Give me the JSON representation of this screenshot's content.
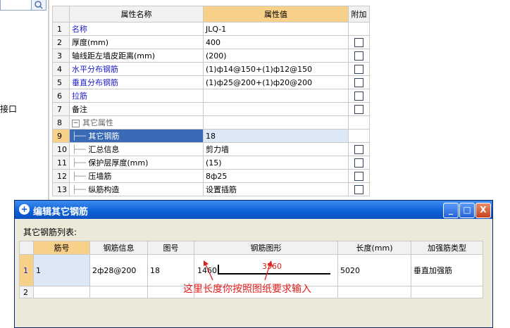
{
  "left_panel": {
    "label": "接口"
  },
  "prop_grid": {
    "headers": {
      "num": "",
      "name": "属性名称",
      "value": "属性值",
      "extra": "附加"
    },
    "rows": [
      {
        "n": "1",
        "name": "名称",
        "value": "JLQ-1",
        "checkbox": false
      },
      {
        "n": "2",
        "name": "厚度(mm)",
        "value": "400",
        "checkbox": true
      },
      {
        "n": "3",
        "name": "轴线距左墙皮距离(mm)",
        "value": "(200)",
        "checkbox": true
      },
      {
        "n": "4",
        "name": "水平分布钢筋",
        "value": "(1)ф14@150+(1)ф12@150",
        "checkbox": true
      },
      {
        "n": "5",
        "name": "垂直分布钢筋",
        "value": "(1)ф25@200+(1)ф20@200",
        "checkbox": true
      },
      {
        "n": "6",
        "name": "拉筋",
        "value": "",
        "checkbox": true
      },
      {
        "n": "7",
        "name": "备注",
        "value": "",
        "checkbox": true
      },
      {
        "n": "8",
        "name": "其它属性",
        "value": "",
        "checkbox": false
      },
      {
        "n": "9",
        "name": "其它钢筋",
        "value": "18",
        "checkbox": false
      },
      {
        "n": "10",
        "name": "汇总信息",
        "value": "剪力墙",
        "checkbox": true
      },
      {
        "n": "11",
        "name": "保护层厚度(mm)",
        "value": "(15)",
        "checkbox": true
      },
      {
        "n": "12",
        "name": "压墙筋",
        "value": "8ф25",
        "checkbox": true
      },
      {
        "n": "13",
        "name": "纵筋构造",
        "value": "设置插筋",
        "checkbox": true
      }
    ]
  },
  "dialog": {
    "title": "编辑其它钢筋",
    "list_label": "其它钢筋列表:",
    "buttons": {
      "minimize": "_",
      "maximize": "□",
      "close": "X"
    },
    "columns": [
      "",
      "筋号",
      "钢筋信息",
      "图号",
      "钢筋图形",
      "长度(mm)",
      "加强筋类型"
    ],
    "rows": [
      {
        "n": "1",
        "bar_no": "1",
        "info": "2ф28@200",
        "fig": "18",
        "shape_left": "1460",
        "shape_mid": "3560",
        "length": "5020",
        "type": "垂直加强筋"
      },
      {
        "n": "2",
        "bar_no": "",
        "info": "",
        "fig": "",
        "shape_left": "",
        "shape_mid": "",
        "length": "",
        "type": ""
      }
    ],
    "annotation": "这里长度你按照图纸要求输入"
  },
  "colors": {
    "header_selected": "#f7d08a",
    "title_bar": "#0b5fd7",
    "annotation": "#e02020",
    "link_blue": "#1c1cc8"
  }
}
